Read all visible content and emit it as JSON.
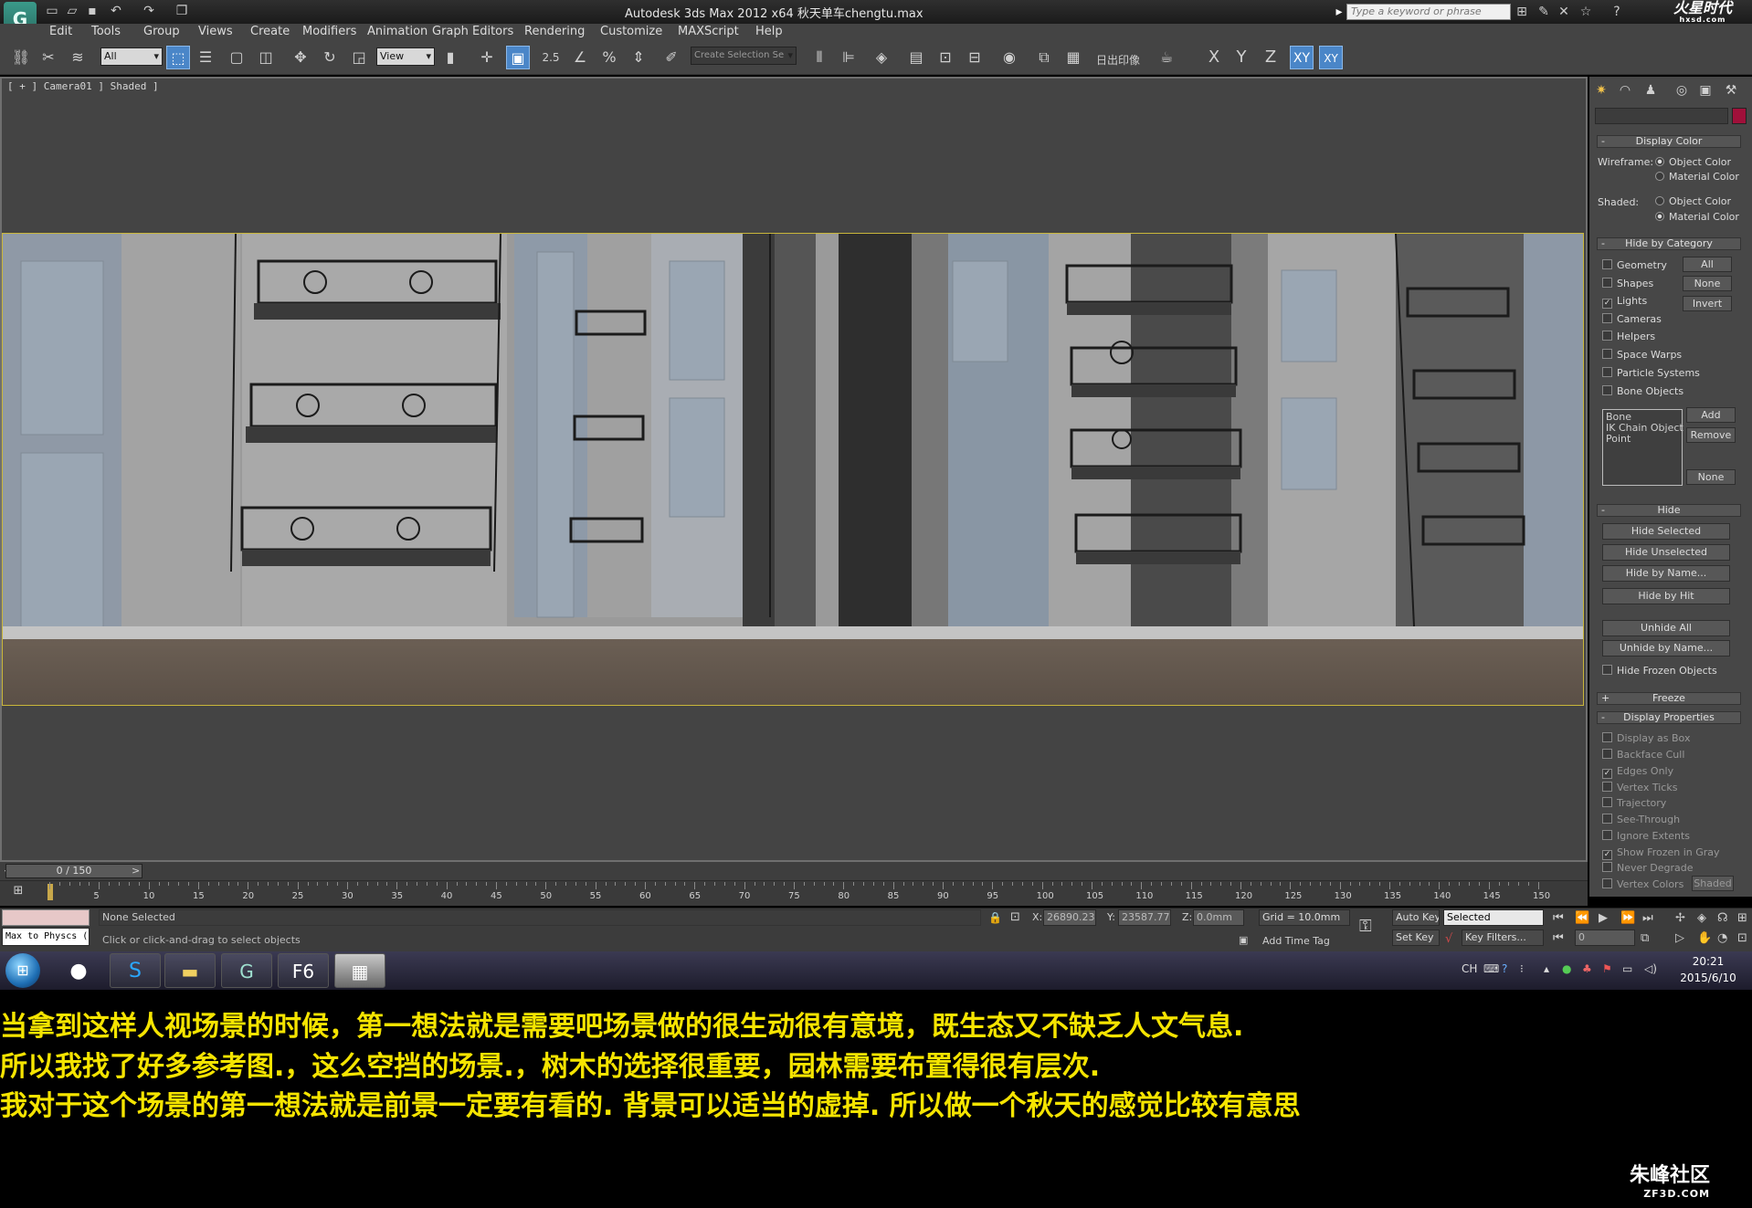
{
  "window": {
    "title": "Autodesk 3ds Max  2012 x64      秋天单车chengtu.max",
    "search_placeholder": "Type a keyword or phrase",
    "brand": "火星时代",
    "brand_sub": "hxsd.com"
  },
  "menu": [
    "Edit",
    "Tools",
    "Group",
    "Views",
    "Create",
    "Modifiers",
    "Animation",
    "Graph Editors",
    "Rendering",
    "Customize",
    "MAXScript",
    "Help"
  ],
  "toolbar": {
    "filter_value": "All",
    "coord_system": "View",
    "snap_angle": "2.5",
    "selection_set": "Create Selection Se",
    "axis_x": "X",
    "axis_y": "Y",
    "axis_z": "Z",
    "axis_xy": "XY",
    "axis_xy2": "XY",
    "render_label": "日出印像"
  },
  "viewport": {
    "label": "[ + ] Camera01 ] Shaded ]"
  },
  "command_panel": {
    "display_color": {
      "title": "Display Color",
      "wireframe_label": "Wireframe:",
      "shaded_label": "Shaded:",
      "object_color": "Object Color",
      "material_color": "Material Color"
    },
    "hide_by_category": {
      "title": "Hide by Category",
      "items": [
        {
          "label": "Geometry",
          "checked": false
        },
        {
          "label": "Shapes",
          "checked": false
        },
        {
          "label": "Lights",
          "checked": true
        },
        {
          "label": "Cameras",
          "checked": false
        },
        {
          "label": "Helpers",
          "checked": false
        },
        {
          "label": "Space Warps",
          "checked": false
        },
        {
          "label": "Particle Systems",
          "checked": false
        },
        {
          "label": "Bone Objects",
          "checked": false
        }
      ],
      "all_btn": "All",
      "none_btn": "None",
      "invert_btn": "Invert",
      "list_items": [
        "Bone",
        "IK Chain Object",
        "Point"
      ],
      "add_btn": "Add",
      "remove_btn": "Remove",
      "none2_btn": "None"
    },
    "hide": {
      "title": "Hide",
      "buttons": [
        "Hide Selected",
        "Hide Unselected",
        "Hide by Name...",
        "Hide by Hit"
      ],
      "unhide_all": "Unhide All",
      "unhide_by_name": "Unhide by Name...",
      "hide_frozen": "Hide Frozen Objects"
    },
    "freeze": {
      "title": "Freeze"
    },
    "display_properties": {
      "title": "Display Properties",
      "items": [
        {
          "label": "Display as Box",
          "checked": false
        },
        {
          "label": "Backface Cull",
          "checked": false
        },
        {
          "label": "Edges Only",
          "checked": true
        },
        {
          "label": "Vertex Ticks",
          "checked": false
        },
        {
          "label": "Trajectory",
          "checked": false
        },
        {
          "label": "See-Through",
          "checked": false
        },
        {
          "label": "Ignore Extents",
          "checked": false
        },
        {
          "label": "Show Frozen in Gray",
          "checked": true
        },
        {
          "label": "Never Degrade",
          "checked": false
        },
        {
          "label": "Vertex Colors",
          "checked": false
        }
      ],
      "shaded_btn": "Shaded"
    }
  },
  "timeline": {
    "slider": "0 / 150",
    "ticks": [
      "5",
      "10",
      "15",
      "20",
      "25",
      "30",
      "35",
      "40",
      "45",
      "50",
      "55",
      "60",
      "65",
      "70",
      "75",
      "80",
      "85",
      "90",
      "95",
      "100",
      "105",
      "110",
      "115",
      "120",
      "125",
      "130",
      "135",
      "140",
      "145",
      "150"
    ]
  },
  "status": {
    "maxscript": "Max to Physcs (",
    "selection": "None Selected",
    "prompt": "Click or click-and-drag to select objects",
    "x_label": "X:",
    "x_value": "26890.238",
    "y_label": "Y:",
    "y_value": "23587.771",
    "z_label": "Z:",
    "z_value": "0.0mm",
    "grid": "Grid = 10.0mm",
    "add_time_tag": "Add Time Tag",
    "auto_key": "Auto Key",
    "set_key": "Set Key",
    "key_mode": "Selected",
    "key_filters": "Key Filters...",
    "frame": "0"
  },
  "taskbar": {
    "ime": "CH",
    "time": "20:21",
    "date": "2015/6/10"
  },
  "caption": [
    "      当拿到这样人视场景的时候，第一想法就是需要吧场景做的很生动很有意境，既生态又不缺乏人文气息.",
    "所以我找了好多参考图.，这么空挡的场景.，树木的选择很重要，园林需要布置得很有层次.",
    "我对于这个场景的第一想法就是前景一定要有看的. 背景可以适当的虚掉. 所以做一个秋天的感觉比较有意思"
  ],
  "watermark": {
    "name": "朱峰社区",
    "url": "ZF3D.COM"
  },
  "colors": {
    "caption": "#f5e400",
    "viewport_border": "#c9b63a",
    "active_tool": "#4a86c8"
  }
}
